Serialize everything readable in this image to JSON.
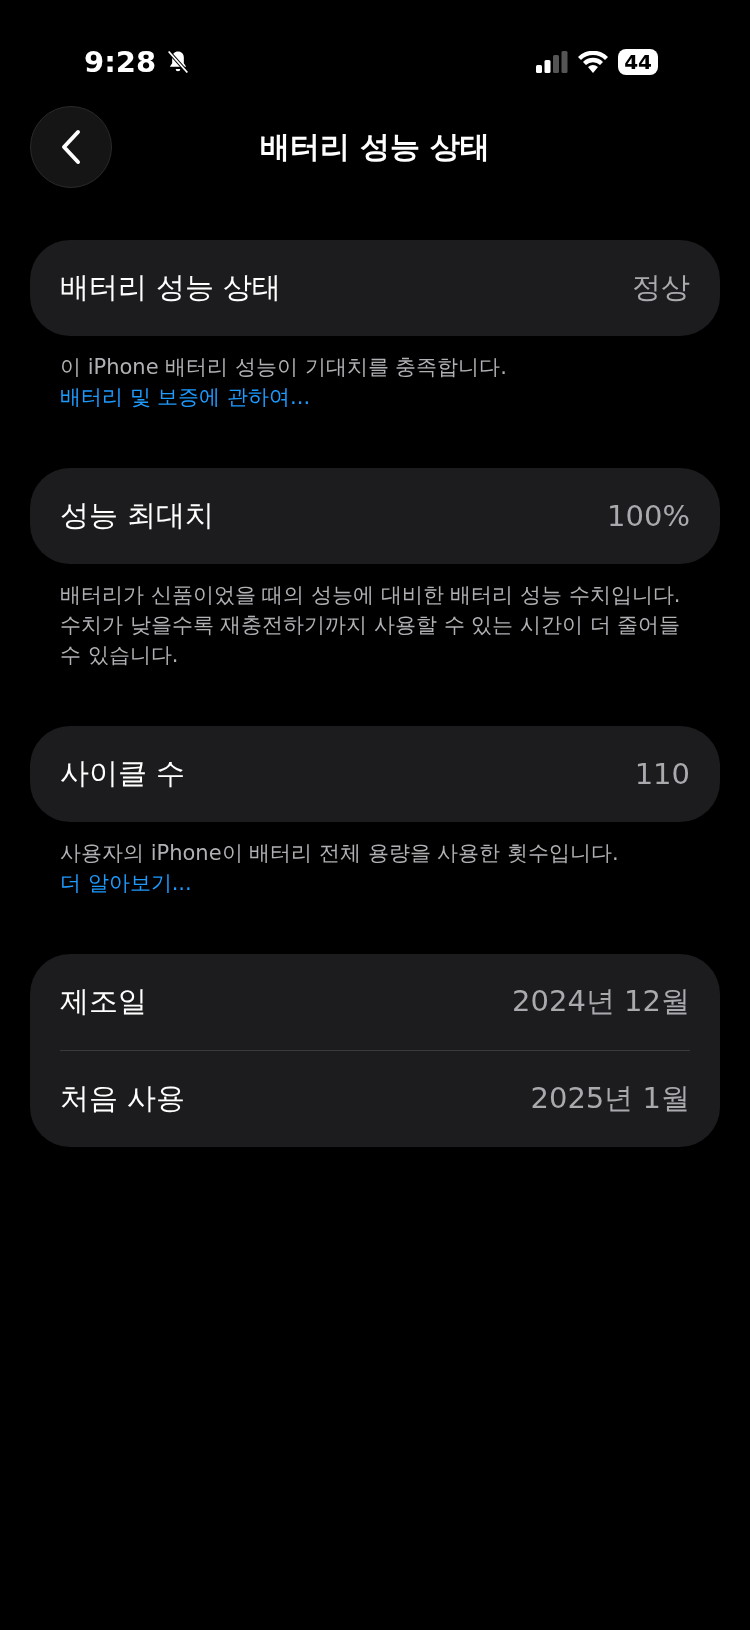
{
  "status_bar": {
    "time": "9:28",
    "silent": true,
    "battery": "44"
  },
  "nav": {
    "title": "배터리 성능 상태"
  },
  "sections": [
    {
      "rows": [
        {
          "label": "배터리 성능 상태",
          "value": "정상"
        }
      ],
      "footer": "이 iPhone 배터리 성능이 기대치를 충족합니다. ",
      "footer_link": "배터리 및 보증에 관하여..."
    },
    {
      "rows": [
        {
          "label": "성능 최대치",
          "value": "100%"
        }
      ],
      "footer": "배터리가 신품이었을 때의 성능에 대비한 배터리 성능 수치입니다. 수치가 낮을수록 재충전하기까지 사용할 수 있는 시간이 더 줄어들 수 있습니다."
    },
    {
      "rows": [
        {
          "label": "사이클 수",
          "value": "110"
        }
      ],
      "footer": "사용자의 iPhone이 배터리 전체 용량을 사용한 횟수입니다.",
      "footer_link": "더 알아보기..."
    },
    {
      "rows": [
        {
          "label": "제조일",
          "value": "2024년 12월"
        },
        {
          "label": "처음 사용",
          "value": "2025년 1월"
        }
      ]
    }
  ]
}
